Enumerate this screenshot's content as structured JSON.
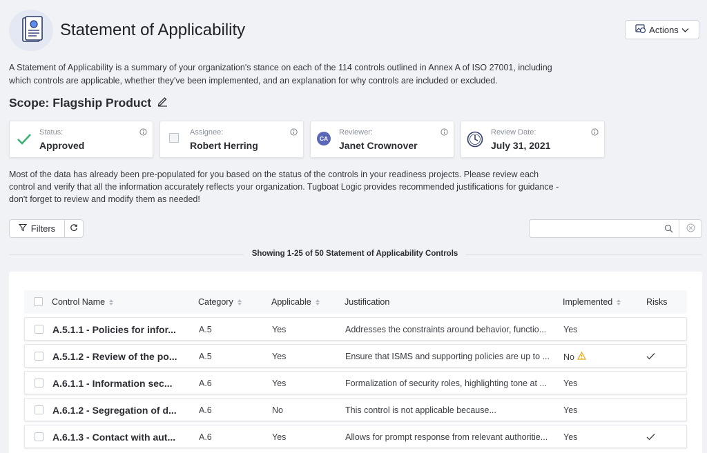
{
  "header": {
    "title": "Statement of Applicability",
    "actions_label": "Actions"
  },
  "intro": "A Statement of Applicability is a summary of your organization's stance on each of the 114 controls outlined in Annex A of ISO 27001, including which controls are applicable, whether they've been implemented, and an explanation for why controls are included or excluded.",
  "scope": "Scope: Flagship Product",
  "cards": {
    "status": {
      "label": "Status:",
      "value": "Approved"
    },
    "assignee": {
      "label": "Assignee:",
      "value": "Robert Herring"
    },
    "reviewer": {
      "label": "Reviewer:",
      "value": "Janet Crownover",
      "initials": "CA"
    },
    "review_date": {
      "label": "Review Date:",
      "value": "July 31, 2021"
    }
  },
  "note": "Most of the data has already been pre-populated for you based on the status of the controls in your readiness projects. Please review each control and verify that all the information accurately reflects your organization. Tugboat Logic provides recommended justifications for guidance - don't forget to review and modify them as needed!",
  "toolbar": {
    "filters_label": "Filters",
    "search_placeholder": ""
  },
  "showing": "Showing 1-25 of 50 Statement of Applicability Controls",
  "table": {
    "columns": {
      "name": "Control Name",
      "category": "Category",
      "applicable": "Applicable",
      "justification": "Justification",
      "implemented": "Implemented",
      "risks": "Risks"
    },
    "rows": [
      {
        "name": "A.5.1.1 - Policies for infor...",
        "category": "A.5",
        "applicable": "Yes",
        "justification": "Addresses the constraints around behavior, functio...",
        "implemented": "Yes",
        "warning": false,
        "risk": false
      },
      {
        "name": "A.5.1.2 - Review of the po...",
        "category": "A.5",
        "applicable": "Yes",
        "justification": "Ensure that ISMS and supporting policies are up to ...",
        "implemented": "No",
        "warning": true,
        "risk": true
      },
      {
        "name": "A.6.1.1 - Information sec...",
        "category": "A.6",
        "applicable": "Yes",
        "justification": "Formalization of security roles, highlighting tone at ...",
        "implemented": "Yes",
        "warning": false,
        "risk": false
      },
      {
        "name": "A.6.1.2 - Segregation of d...",
        "category": "A.6",
        "applicable": "No",
        "justification": "This control is not applicable because...",
        "implemented": "Yes",
        "warning": false,
        "risk": false
      },
      {
        "name": "A.6.1.3 - Contact with aut...",
        "category": "A.6",
        "applicable": "Yes",
        "justification": "Allows for prompt response from relevant authoritie...",
        "implemented": "Yes",
        "warning": false,
        "risk": true
      }
    ]
  },
  "colors": {
    "accent": "#5a67b8",
    "success": "#3bb273",
    "warning": "#e8a317"
  }
}
